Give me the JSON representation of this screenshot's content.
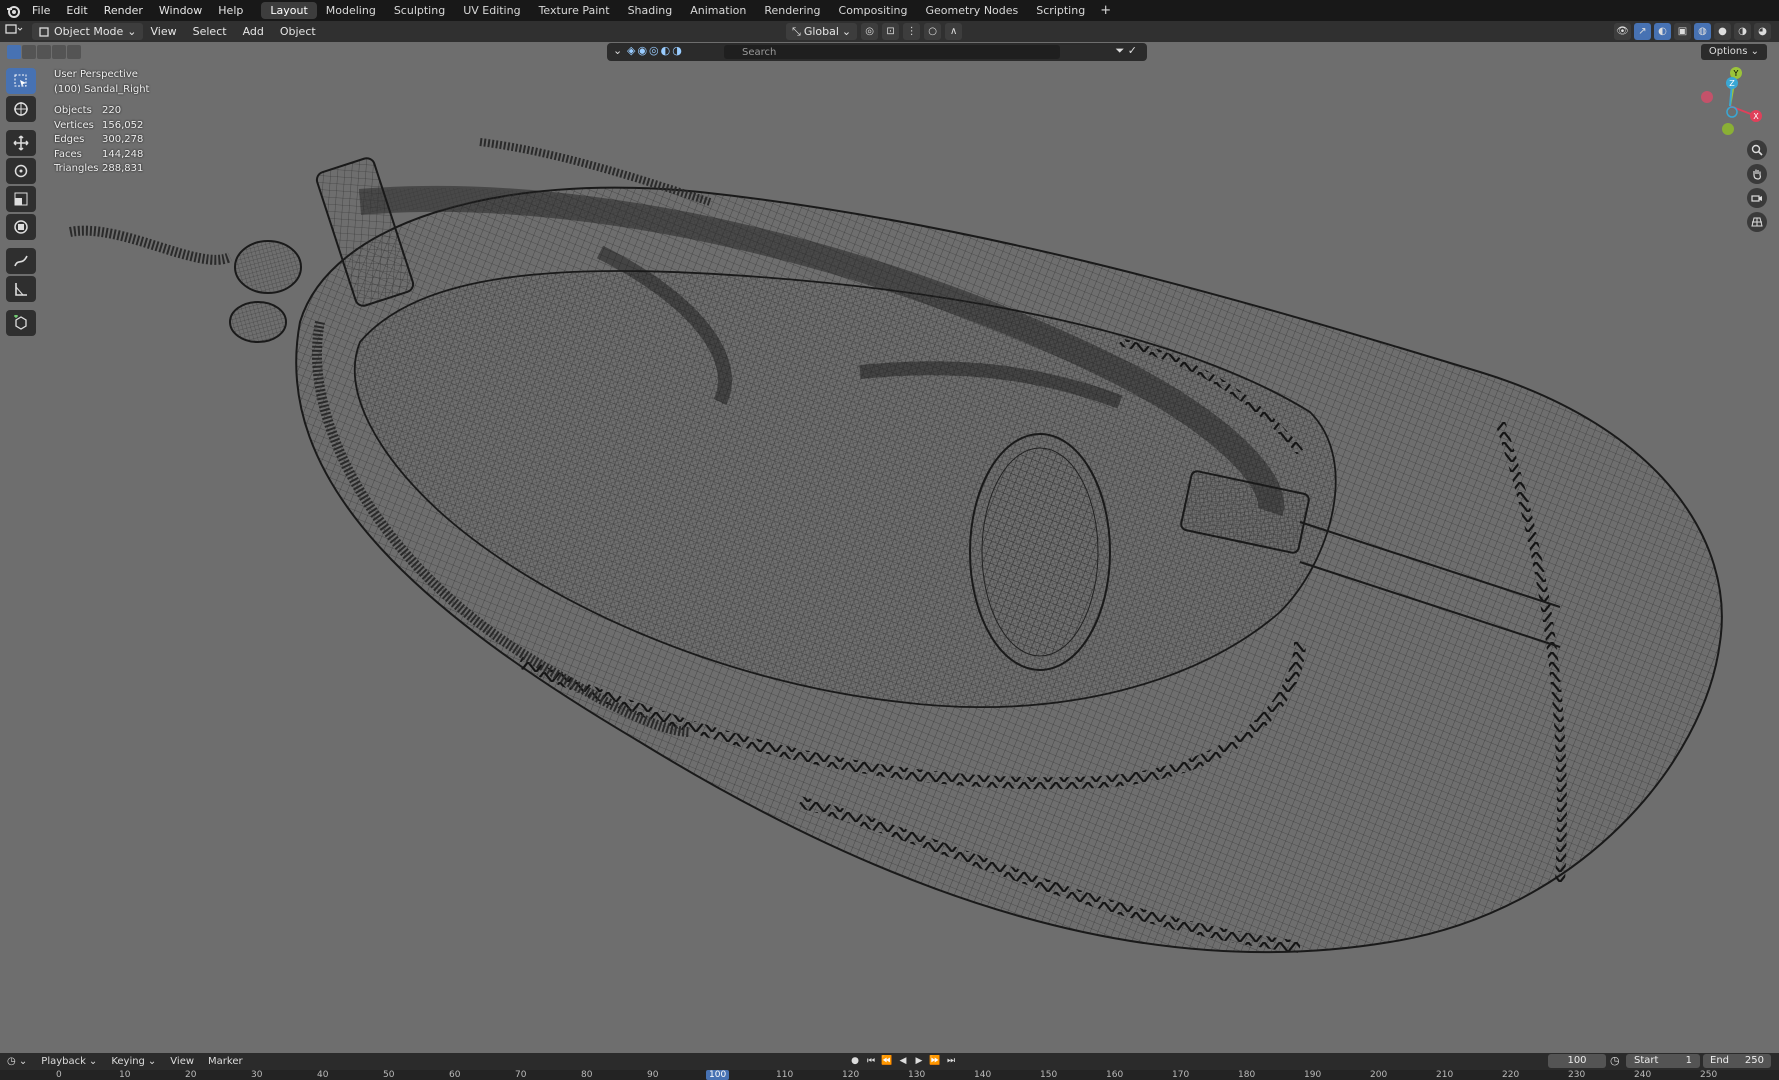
{
  "topbar": {
    "menus": [
      "File",
      "Edit",
      "Render",
      "Window",
      "Help"
    ],
    "workspaces": [
      "Layout",
      "Modeling",
      "Sculpting",
      "UV Editing",
      "Texture Paint",
      "Shading",
      "Animation",
      "Rendering",
      "Compositing",
      "Geometry Nodes",
      "Scripting"
    ],
    "active_workspace": "Layout"
  },
  "header": {
    "mode": "Object Mode",
    "menus": [
      "View",
      "Select",
      "Add",
      "Object"
    ],
    "transform_orientation": "Global"
  },
  "viewport": {
    "search_placeholder": "Search",
    "options_label": "Options",
    "view_name": "User Perspective",
    "object_name": "(100) Sandal_Right",
    "stats": [
      {
        "label": "Objects",
        "value": "220"
      },
      {
        "label": "Vertices",
        "value": "156,052"
      },
      {
        "label": "Edges",
        "value": "300,278"
      },
      {
        "label": "Faces",
        "value": "144,248"
      },
      {
        "label": "Triangles",
        "value": "288,831"
      }
    ],
    "gizmo_axes": {
      "x": "X",
      "y": "Y",
      "z": "Z"
    },
    "colors": {
      "background": "#6e6e6e",
      "wire": "#1e1e1e",
      "accent": "#4772b3"
    }
  },
  "timeline": {
    "menus": [
      "Playback",
      "Keying",
      "View",
      "Marker"
    ],
    "current_frame": "100",
    "start_label": "Start",
    "start_value": "1",
    "end_label": "End",
    "end_value": "250",
    "ruler_ticks": [
      "0",
      "10",
      "20",
      "30",
      "40",
      "50",
      "60",
      "70",
      "80",
      "90",
      "100",
      "110",
      "120",
      "130",
      "140",
      "150",
      "160",
      "170",
      "180",
      "190",
      "200",
      "210",
      "220",
      "230",
      "240",
      "250"
    ]
  }
}
